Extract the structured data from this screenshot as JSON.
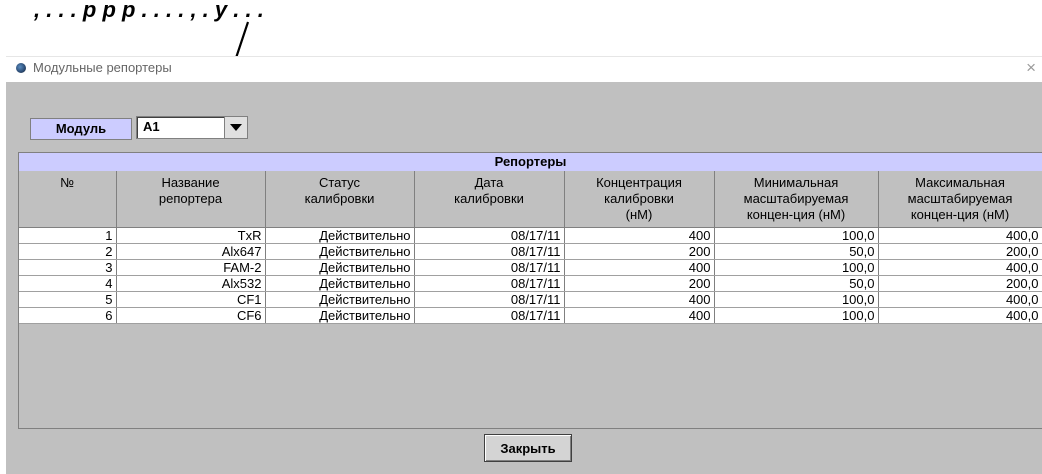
{
  "caption_fragment": ", . . .   р   р   р   . . . .   ,   .   у   . . .",
  "window": {
    "title": "Модульные репортеры",
    "close_glyph": "×"
  },
  "module": {
    "label": "Модуль",
    "selected": "A1"
  },
  "table": {
    "caption": "Репортеры",
    "columns": [
      "№",
      "Название\nрепортера",
      "Статус\nкалибровки",
      "Дата\nкалибровки",
      "Концентрация\nкалибровки\n(нМ)",
      "Минимальная\nмасштабируемая\nконцен-ция (нМ)",
      "Максимальная\nмасштабируемая\nконцен-ция (нМ)"
    ],
    "rows": [
      [
        "1",
        "TxR",
        "Действительно",
        "08/17/11",
        "400",
        "100,0",
        "400,0"
      ],
      [
        "2",
        "Alx647",
        "Действительно",
        "08/17/11",
        "200",
        "50,0",
        "200,0"
      ],
      [
        "3",
        "FAM-2",
        "Действительно",
        "08/17/11",
        "400",
        "100,0",
        "400,0"
      ],
      [
        "4",
        "Alx532",
        "Действительно",
        "08/17/11",
        "200",
        "50,0",
        "200,0"
      ],
      [
        "5",
        "CF1",
        "Действительно",
        "08/17/11",
        "400",
        "100,0",
        "400,0"
      ],
      [
        "6",
        "CF6",
        "Действительно",
        "08/17/11",
        "400",
        "100,0",
        "400,0"
      ]
    ]
  },
  "buttons": {
    "close": "Закрыть"
  },
  "colors": {
    "panel": "#c0c0c0",
    "header_lavender": "#ccccff",
    "cell": "#ffffff"
  }
}
